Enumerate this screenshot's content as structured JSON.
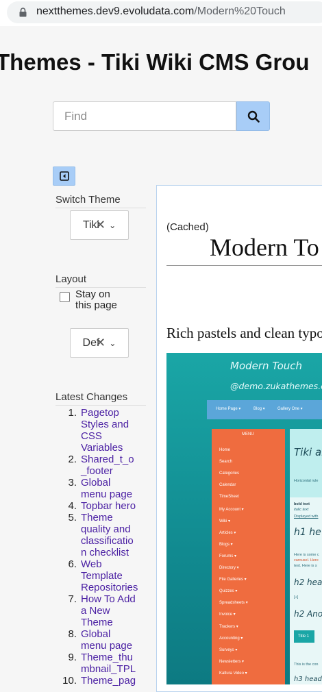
{
  "browser": {
    "url_host": "nextthemes.dev9.evoludata.com",
    "url_path": "/Modern%20Touch"
  },
  "site": {
    "title": "Themes - Tiki Wiki CMS Grou"
  },
  "search": {
    "placeholder": "Find"
  },
  "sidebar": {
    "switch_theme": {
      "title": "Switch Theme",
      "value": "Tiki"
    },
    "layout": {
      "title": "Layout",
      "stay_label_line1": "Stay on",
      "stay_label_line2": "this page",
      "value": "Def"
    },
    "latest_changes": {
      "title": "Latest Changes",
      "items": [
        {
          "num": "1.",
          "lines": [
            "Pagetop",
            "Styles and",
            "CSS",
            "Variables"
          ]
        },
        {
          "num": "2.",
          "lines": [
            "Shared_t_o",
            "_footer"
          ]
        },
        {
          "num": "3.",
          "lines": [
            "Global",
            "menu page"
          ]
        },
        {
          "num": "4.",
          "lines": [
            "Topbar hero"
          ]
        },
        {
          "num": "5.",
          "lines": [
            "Theme",
            "quality and",
            "classificatio",
            "n checklist"
          ]
        },
        {
          "num": "6.",
          "lines": [
            "Web",
            "Template",
            "Repositories"
          ]
        },
        {
          "num": "7.",
          "lines": [
            "How To Add",
            "a New",
            "Theme"
          ]
        },
        {
          "num": "8.",
          "lines": [
            "Global",
            "menu page"
          ]
        },
        {
          "num": "9.",
          "lines": [
            "Theme_thu",
            "mbnail_TPL"
          ]
        },
        {
          "num": "10.",
          "lines": [
            "Theme_pag"
          ]
        }
      ]
    }
  },
  "main": {
    "cached": "(Cached)",
    "page_title": "Modern To",
    "description": "Rich pastels and clean typo"
  },
  "screenshot": {
    "title": "Modern Touch",
    "subtitle": "@demo.zukathemes.co",
    "nav": [
      "Home Page ▾",
      "Blog ▾",
      "Gallery One ▾"
    ],
    "menu_header": "MENU",
    "menu_items": [
      "Home",
      "Search",
      "Categories",
      "Calendar",
      "TimeSheet",
      "My Account ▾",
      "Wiki ▾",
      "Articles ▾",
      "Blogs ▾",
      "Forums ▾",
      "Directory ▾",
      "File Galleries ▾",
      "Quizzes ▾",
      "Spreadsheets ▾",
      "Invoice ▾",
      "Trackers ▾",
      "Accounting ▾",
      "Surveys ▾",
      "Newsletters ▾",
      "Kaltura Video ▾"
    ],
    "main_texts": {
      "tiki": "Tiki ar",
      "horiz": "Horizontal rule",
      "bold": "bold text",
      "italic": "italic text",
      "displayed": "Displayed with",
      "h1": "h1 he",
      "body1": "Here is some c",
      "body2": "carousel. Here",
      "body3": "text. Here is s",
      "h2a": "h2 hea",
      "plus": "[+]",
      "h2b": "h2 Ano",
      "tab": "Title 1",
      "contain": "This is the con",
      "h3": "h3 head"
    }
  },
  "colors": {
    "accent": "#a8cdf7",
    "link": "#4a1fa3",
    "shot_teal": "#1aa6a6",
    "shot_orange": "#ef6c3f"
  },
  "icons": [
    "lock-icon",
    "search-icon",
    "sidebar-toggle-icon",
    "clear-x-icon",
    "chevron-down-icon"
  ]
}
